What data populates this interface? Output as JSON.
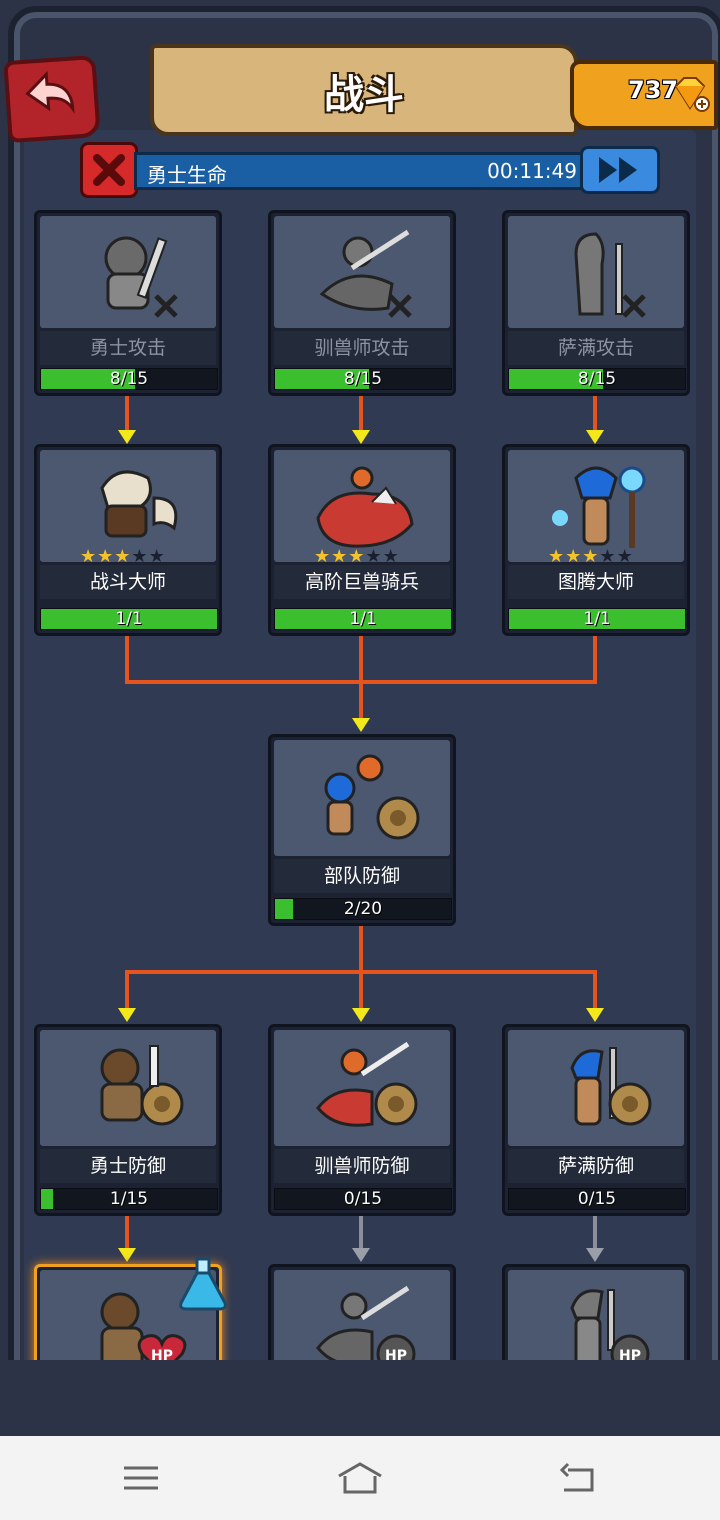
{
  "header": {
    "title": "战斗",
    "gems": "737"
  },
  "status": {
    "label": "勇士生命",
    "time": "00:11:49"
  },
  "colors": {
    "progress_green": "#3bbf2e",
    "connector_orange": "#e4541c",
    "arrow_yellow": "#f2e81a",
    "star_gold": "#f4c22a"
  },
  "cards": {
    "warrior_attack": {
      "name": "勇士攻击",
      "progress": "8/15",
      "fraction": 0.533
    },
    "tamer_attack": {
      "name": "驯兽师攻击",
      "progress": "8/15",
      "fraction": 0.533
    },
    "shaman_attack": {
      "name": "萨满攻击",
      "progress": "8/15",
      "fraction": 0.533
    },
    "battle_master": {
      "name": "战斗大师",
      "progress": "1/1",
      "fraction": 1,
      "stars": 3,
      "max_stars": 5
    },
    "beast_rider": {
      "name": "高阶巨兽骑兵",
      "progress": "1/1",
      "fraction": 1,
      "stars": 3,
      "max_stars": 5
    },
    "totem_master": {
      "name": "图腾大师",
      "progress": "1/1",
      "fraction": 1,
      "stars": 3,
      "max_stars": 5
    },
    "troop_defense": {
      "name": "部队防御",
      "progress": "2/20",
      "fraction": 0.1
    },
    "warrior_defense": {
      "name": "勇士防御",
      "progress": "1/15",
      "fraction": 0.067
    },
    "tamer_defense": {
      "name": "驯兽师防御",
      "progress": "0/15",
      "fraction": 0
    },
    "shaman_defense": {
      "name": "萨满防御",
      "progress": "0/15",
      "fraction": 0
    }
  },
  "icons": [
    "back-arrow-icon",
    "gem-icon",
    "close-icon",
    "fast-forward-icon",
    "potion-icon",
    "hp-icon",
    "menu-icon",
    "home-icon",
    "back-icon"
  ]
}
